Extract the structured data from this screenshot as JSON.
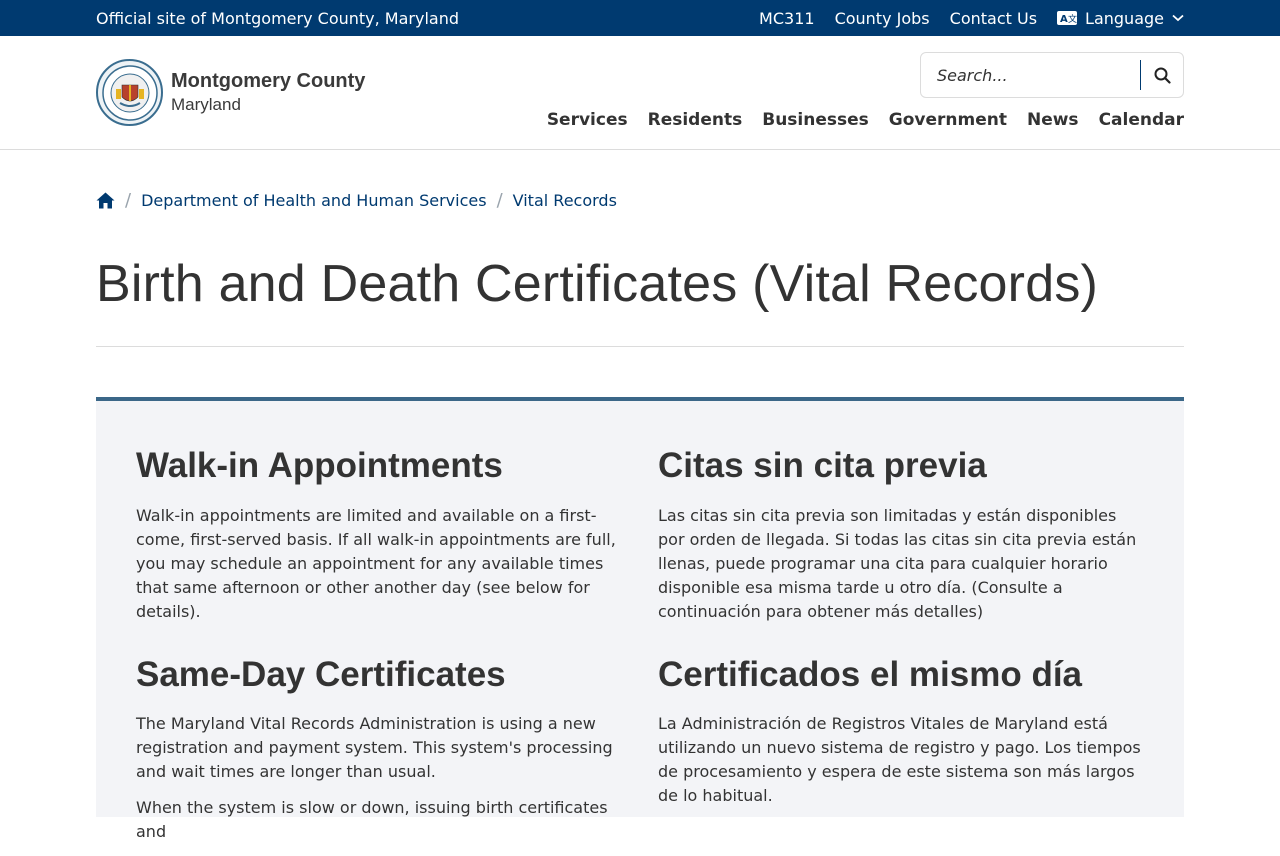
{
  "topbar": {
    "site_label": "Official site of Montgomery County, Maryland",
    "links": [
      "MC311",
      "County Jobs",
      "Contact Us"
    ],
    "language": "Language"
  },
  "header": {
    "logo_line1": "Montgomery County",
    "logo_line2": "Maryland",
    "search_placeholder": "Search...",
    "nav": [
      "Services",
      "Residents",
      "Businesses",
      "Government",
      "News",
      "Calendar"
    ]
  },
  "breadcrumb": {
    "items": [
      "Department of Health and Human Services",
      "Vital Records"
    ]
  },
  "page_title": "Birth and Death Certificates (Vital Records)",
  "content": {
    "left": {
      "h1": "Walk-in Appointments",
      "p1": "Walk-in appointments are limited and available on a first-come, first-served basis. If all walk-in appointments are full, you may schedule an appointment for any available times that same afternoon or other another day (see below for details).",
      "h2": "Same-Day Certificates",
      "p2": "The Maryland Vital Records Administration is using a new registration and payment system. This system's processing and wait times are longer than usual.",
      "p3": "When the system is slow or down, issuing birth certificates and"
    },
    "right": {
      "h1": "Citas sin cita previa",
      "p1": "Las citas sin cita previa son limitadas y están disponibles por orden de llegada. Si todas las citas sin cita previa están llenas, puede programar una cita para cualquier horario disponible esa misma tarde u otro día. (Consulte a continuación para obtener más detalles)",
      "h2": "Certificados el mismo día",
      "p2": "La Administración de Registros Vitales de Maryland está utilizando un nuevo sistema de registro y pago. Los tiempos de procesamiento y espera de este sistema son más largos de lo habitual."
    }
  },
  "colors": {
    "brand_navy": "#003a70",
    "panel_bg": "#f3f4f7",
    "panel_border": "#3b6788"
  }
}
